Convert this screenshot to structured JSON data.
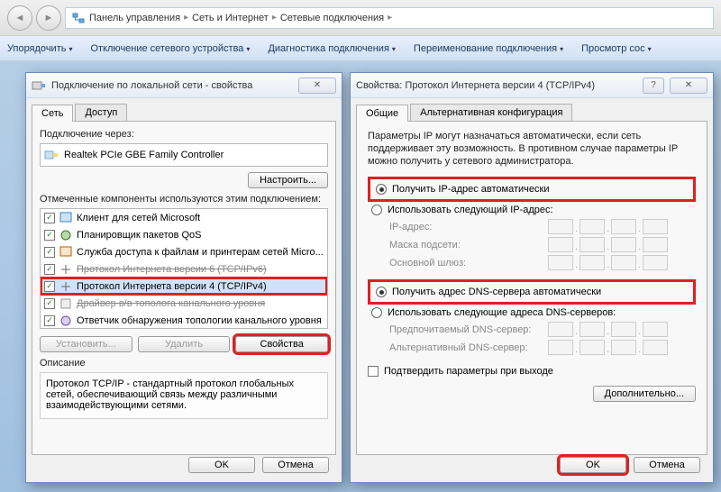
{
  "nav": {
    "crumbs": [
      "Панель управления",
      "Сеть и Интернет",
      "Сетевые подключения"
    ]
  },
  "toolbar": {
    "items": [
      "Упорядочить",
      "Отключение сетевого устройства",
      "Диагностика подключения",
      "Переименование подключения",
      "Просмотр сос"
    ]
  },
  "dlg_left": {
    "title": "Подключение по локальной сети - свойства",
    "tabs": [
      "Сеть",
      "Доступ"
    ],
    "connect_via": "Подключение через:",
    "adapter": "Realtek PCIe GBE Family Controller",
    "configure": "Настроить...",
    "components_label": "Отмеченные компоненты используются этим подключением:",
    "components": [
      "Клиент для сетей Microsoft",
      "Планировщик пакетов QoS",
      "Служба доступа к файлам и принтерам сетей Micro...",
      "Протокол Интернета версии 6 (TCP/IPv6)",
      "Протокол Интернета версии 4 (TCP/IPv4)",
      "Драйвер в/в тополога канального уровня",
      "Ответчик обнаружения топологии канального уровня"
    ],
    "install": "Установить...",
    "uninstall": "Удалить",
    "properties": "Свойства",
    "desc_label": "Описание",
    "desc_text": "Протокол TCP/IP - стандартный протокол глобальных сетей, обеспечивающий связь между различными взаимодействующими сетями.",
    "ok": "OK",
    "cancel": "Отмена"
  },
  "dlg_right": {
    "title": "Свойства: Протокол Интернета версии 4 (TCP/IPv4)",
    "tabs": [
      "Общие",
      "Альтернативная конфигурация"
    ],
    "info": "Параметры IP могут назначаться автоматически, если сеть поддерживает эту возможность. В противном случае параметры IP можно получить у сетевого администратора.",
    "radio_ip_auto": "Получить IP-адрес автоматически",
    "radio_ip_manual": "Использовать следующий IP-адрес:",
    "ip_label": "IP-адрес:",
    "mask_label": "Маска подсети:",
    "gw_label": "Основной шлюз:",
    "radio_dns_auto": "Получить адрес DNS-сервера автоматически",
    "radio_dns_manual": "Использовать следующие адреса DNS-серверов:",
    "dns1_label": "Предпочитаемый DNS-сервер:",
    "dns2_label": "Альтернативный DNS-сервер:",
    "confirm_exit": "Подтвердить параметры при выходе",
    "advanced": "Дополнительно...",
    "ok": "OK",
    "cancel": "Отмена"
  }
}
